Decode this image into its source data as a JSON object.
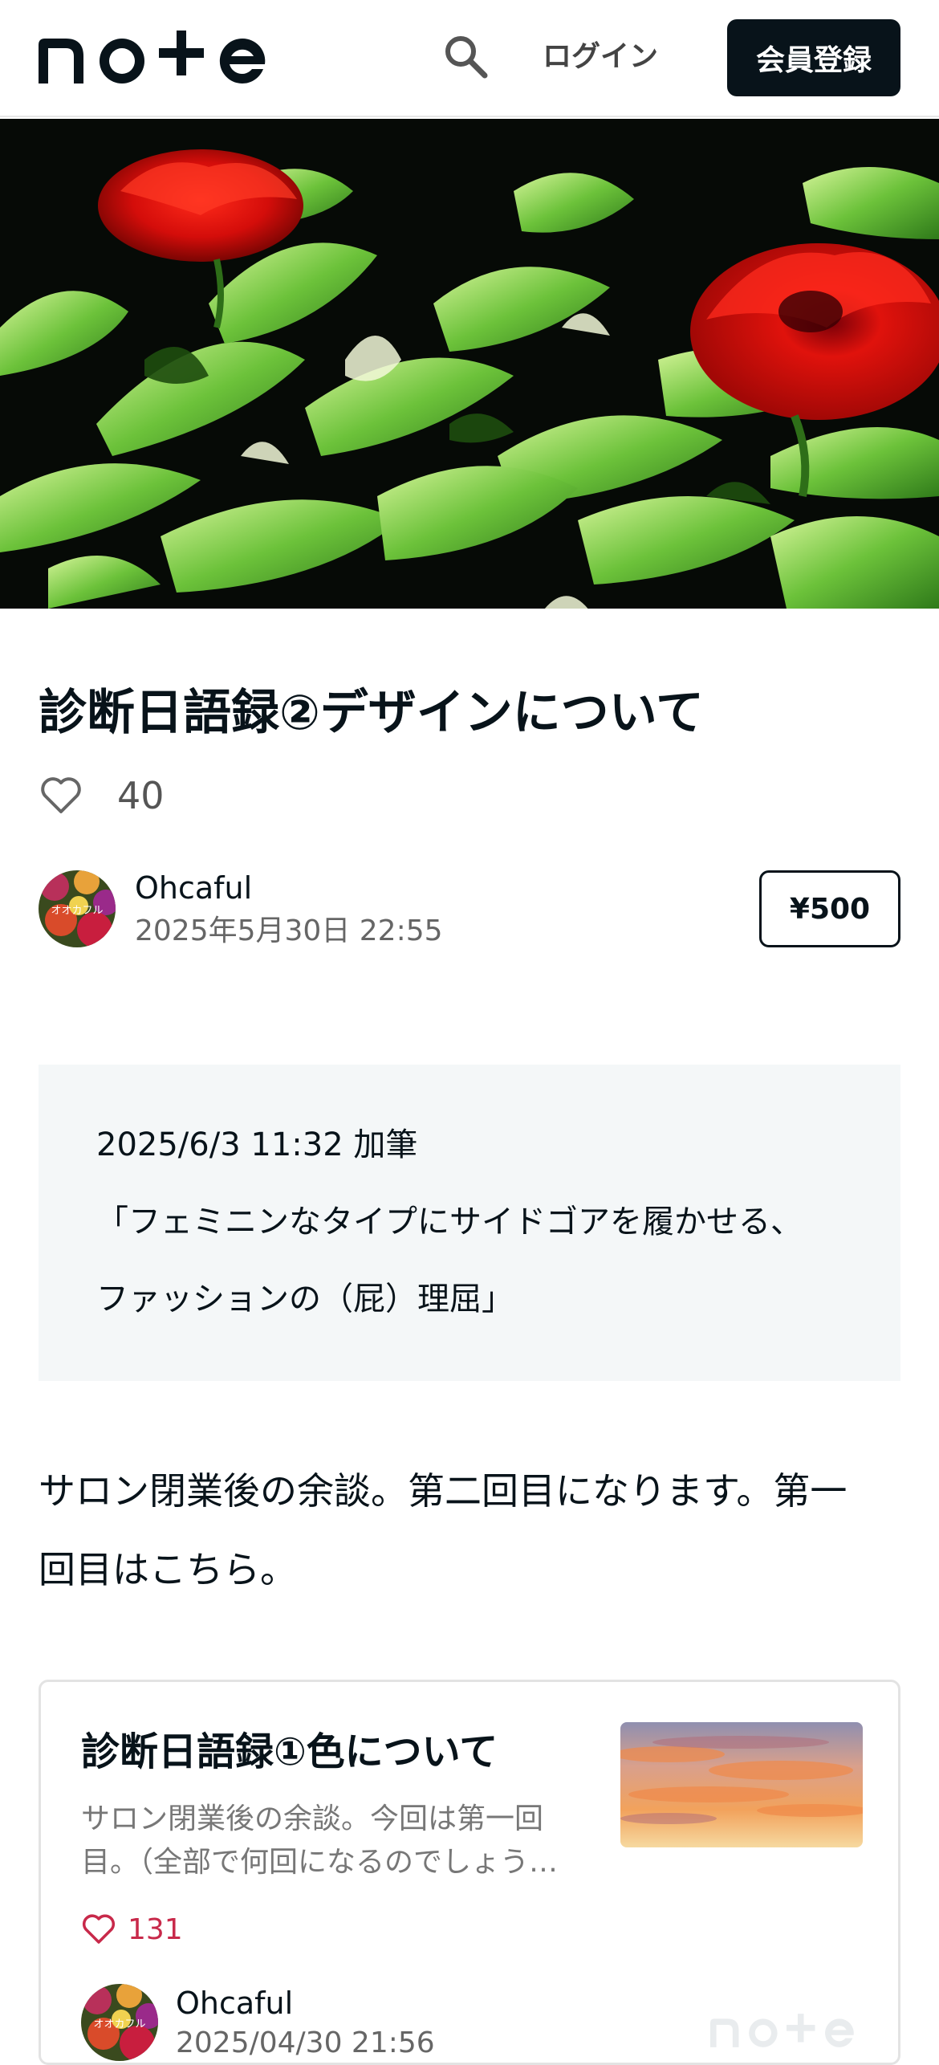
{
  "header": {
    "logo_text": "note",
    "login_label": "ログイン",
    "signup_label": "会員登録"
  },
  "article": {
    "title": "診断日語録②デザインについて",
    "like_count": "40",
    "author": "Ohcaful",
    "date": "2025年5月30日 22:55",
    "price": "¥500",
    "avatar_caption": "オオカフル"
  },
  "notice": {
    "line1": "2025/6/3 11:32 加筆",
    "line2": "「フェミニンなタイプにサイドゴアを履かせる、",
    "line3": "ファッションの（屁）理屈」"
  },
  "body": {
    "line1": "サロン閉業後の余談。第二回目になります。第一",
    "line2": "回目はこちら。"
  },
  "embed": {
    "title": "診断日語録①色について",
    "excerpt_line1": "サロン閉業後の余談。今回は第一回",
    "excerpt_line2": "目。（全部で何回になるのでしょう…",
    "like_count": "131",
    "author": "Ohcaful",
    "date": "2025/04/30 21:56",
    "avatar_caption": "オオカフル",
    "logo_text": "note"
  },
  "colors": {
    "ink": "#08131a",
    "notice_bg": "#f4f7f8",
    "like_pink": "#c8294a"
  }
}
